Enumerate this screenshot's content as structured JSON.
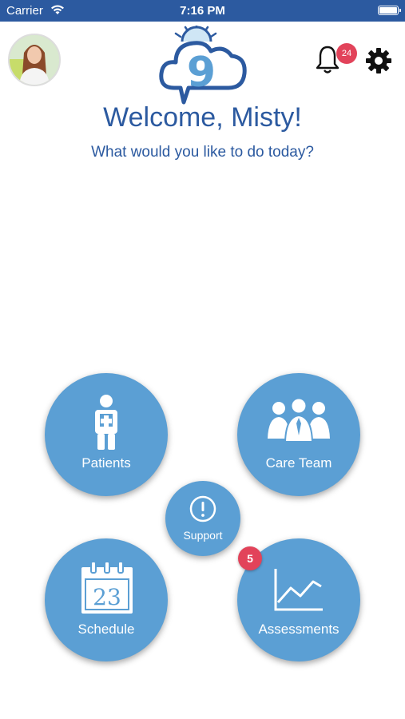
{
  "status_bar": {
    "carrier": "Carrier",
    "time": "7:16 PM"
  },
  "header": {
    "logo_text": "9",
    "notifications_count": "24"
  },
  "main": {
    "welcome": "Welcome, Misty!",
    "subtitle": "What would you like to do today?"
  },
  "menu": {
    "patients": "Patients",
    "care_team": "Care Team",
    "support": "Support",
    "schedule": "Schedule",
    "schedule_day": "23",
    "assessments": "Assessments",
    "assessments_badge": "5"
  },
  "colors": {
    "primary": "#2c5aa0",
    "tile": "#5b9fd4",
    "badge": "#e2435a"
  }
}
